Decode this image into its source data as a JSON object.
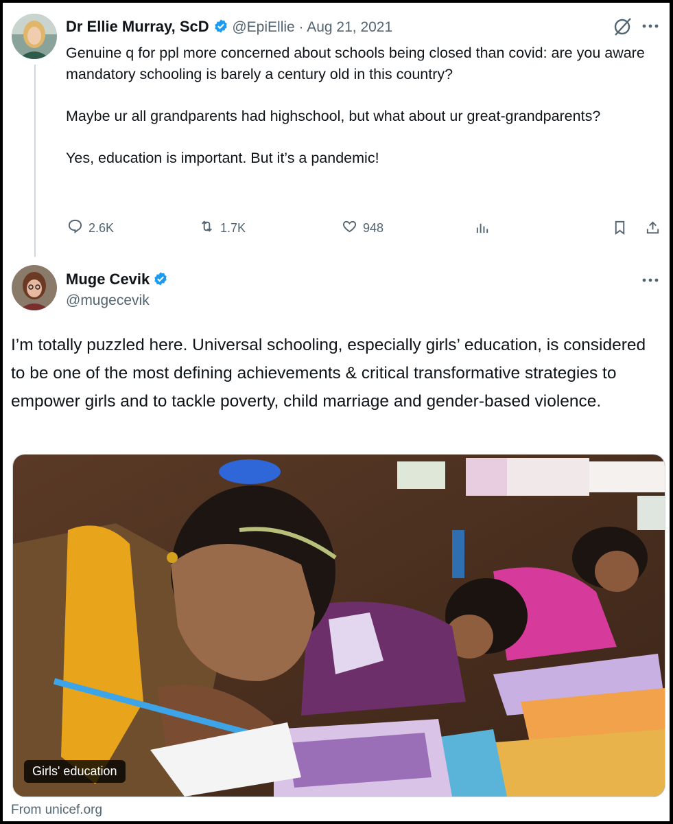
{
  "quoted_tweet": {
    "author_name": "Dr Ellie Murray, ScD",
    "handle_date": "@EpiEllie · Aug 21, 2021",
    "paragraphs": [
      "Genuine q for ppl more concerned about schools being closed than covid: are you aware mandatory schooling is barely a century old in this country?",
      "Maybe ur all grandparents had highschool, but what about ur great-grandparents?",
      "Yes, education is important. But it’s a pandemic!"
    ],
    "actions": {
      "replies": "2.6K",
      "retweets": "1.7K",
      "likes": "948"
    },
    "icons": [
      "no-entry-icon",
      "more-icon",
      "reply-icon",
      "retweet-icon",
      "like-icon",
      "views-icon",
      "bookmark-icon",
      "share-icon"
    ]
  },
  "reply_tweet": {
    "author_name": "Muge Cevik",
    "handle": "@mugecevik",
    "text": "I’m totally puzzled here. Universal schooling, especially girls’ education, is considered to be one of the most defining achievements & critical transformative strategies to empower girls and to tackle poverty, child marriage and gender-based violence.",
    "media_caption": "Girls' education",
    "link_source": "From unicef.org"
  },
  "colors": {
    "verified_blue": "#1d9bf0",
    "muted_text": "#536471",
    "divider": "#cfd9de"
  }
}
